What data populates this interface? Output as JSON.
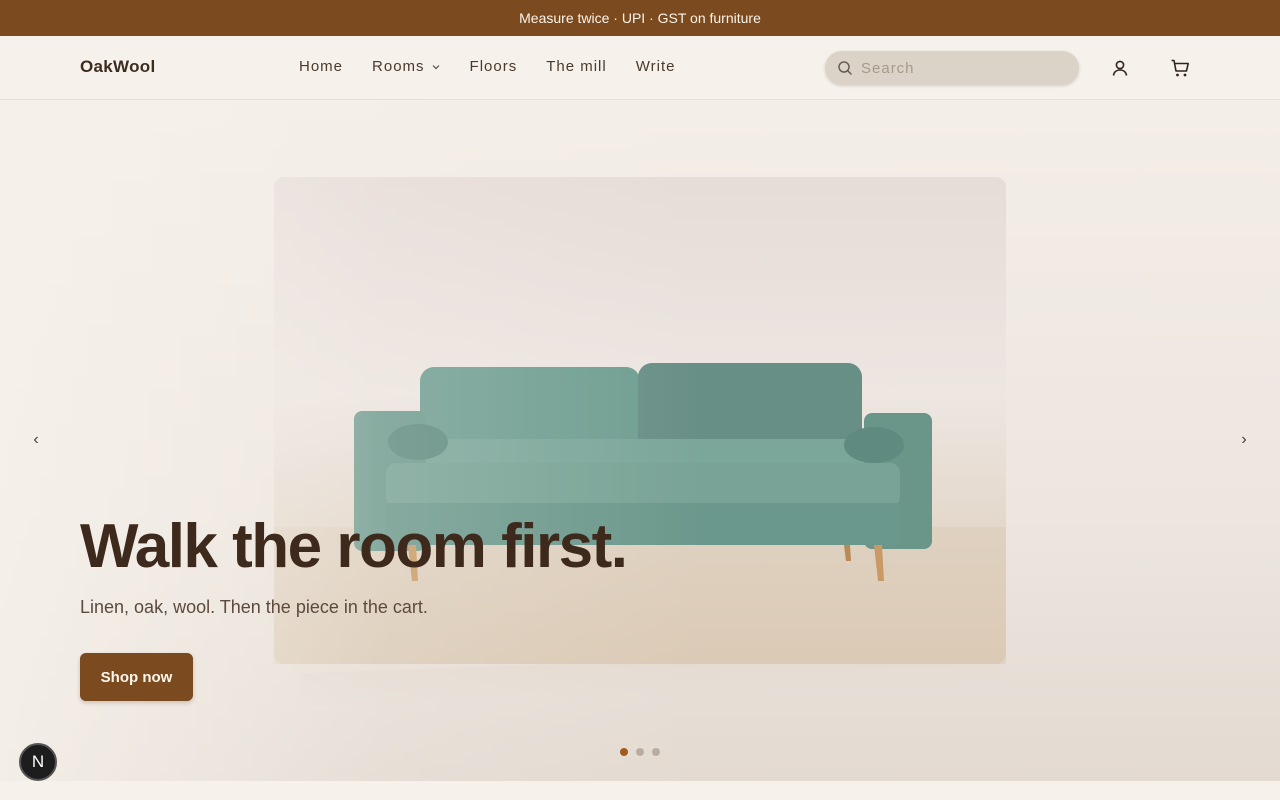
{
  "announcement": "Measure twice · UPI · GST on furniture",
  "brand": "OakWool",
  "nav": {
    "items": [
      {
        "label": "Home"
      },
      {
        "label": "Rooms"
      },
      {
        "label": "Floors"
      },
      {
        "label": "The mill"
      },
      {
        "label": "Write"
      }
    ]
  },
  "search": {
    "placeholder": "Search",
    "value": ""
  },
  "header_icons": {
    "account": "user-icon",
    "cart": "cart-icon"
  },
  "hero": {
    "title": "Walk the room first.",
    "subtitle": "Linen, oak, wool. Then the piece in the cart.",
    "cta_label": "Shop now",
    "prev_label": "‹",
    "next_label": "›",
    "image": "green-velvet-sofa",
    "slides_count": 3,
    "active_slide": 1
  },
  "dev_badge": "N",
  "colors": {
    "accent": "#7b4a1e",
    "dot_active": "#a35b1d",
    "background": "#f6f1eb",
    "sofa": "#6f9e92"
  }
}
